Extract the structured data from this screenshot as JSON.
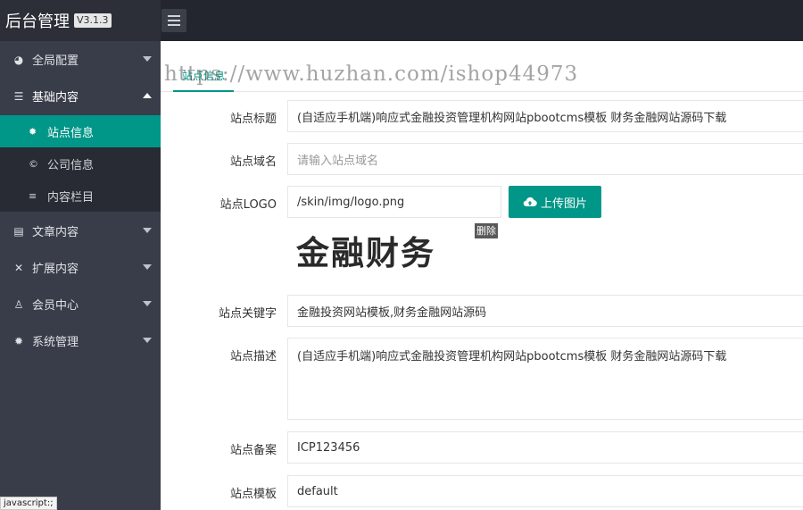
{
  "header": {
    "app_title": "后台管理",
    "version": "V3.1.3"
  },
  "sidebar": {
    "items": [
      {
        "label": "全局配置",
        "icon": "dashboard-icon"
      },
      {
        "label": "基础内容",
        "icon": "sliders-icon",
        "expanded": true,
        "children": [
          {
            "label": "站点信息",
            "icon": "gear-icon",
            "active": true
          },
          {
            "label": "公司信息",
            "icon": "copyright-icon"
          },
          {
            "label": "内容栏目",
            "icon": "list-icon"
          }
        ]
      },
      {
        "label": "文章内容",
        "icon": "document-icon"
      },
      {
        "label": "扩展内容",
        "icon": "expand-icon"
      },
      {
        "label": "会员中心",
        "icon": "user-icon"
      },
      {
        "label": "系统管理",
        "icon": "gear-icon"
      }
    ]
  },
  "status_tip": "javascript:;",
  "watermark": "https://www.huzhan.com/ishop44973",
  "tab": {
    "label": "站点信息"
  },
  "form": {
    "title": {
      "label": "站点标题",
      "value": "(自适应手机端)响应式金融投资管理机构网站pbootcms模板 财务金融网站源码下载"
    },
    "domain": {
      "label": "站点域名",
      "placeholder": "请输入站点域名"
    },
    "logo": {
      "label": "站点LOGO",
      "value": "/skin/img/logo.png",
      "upload_label": "上传图片",
      "preview_text": "金融财务",
      "delete_label": "删除"
    },
    "keywords": {
      "label": "站点关键字",
      "value": "金融投资网站模板,财务金融网站源码"
    },
    "description": {
      "label": "站点描述",
      "value": "(自适应手机端)响应式金融投资管理机构网站pbootcms模板 财务金融网站源码下载"
    },
    "icp": {
      "label": "站点备案",
      "value": "ICP123456"
    },
    "template": {
      "label": "站点模板",
      "value": "default"
    }
  },
  "colors": {
    "accent": "#009688",
    "header_bg": "#23262e",
    "sidebar_bg": "#393d49",
    "submenu_bg": "#282b33"
  }
}
